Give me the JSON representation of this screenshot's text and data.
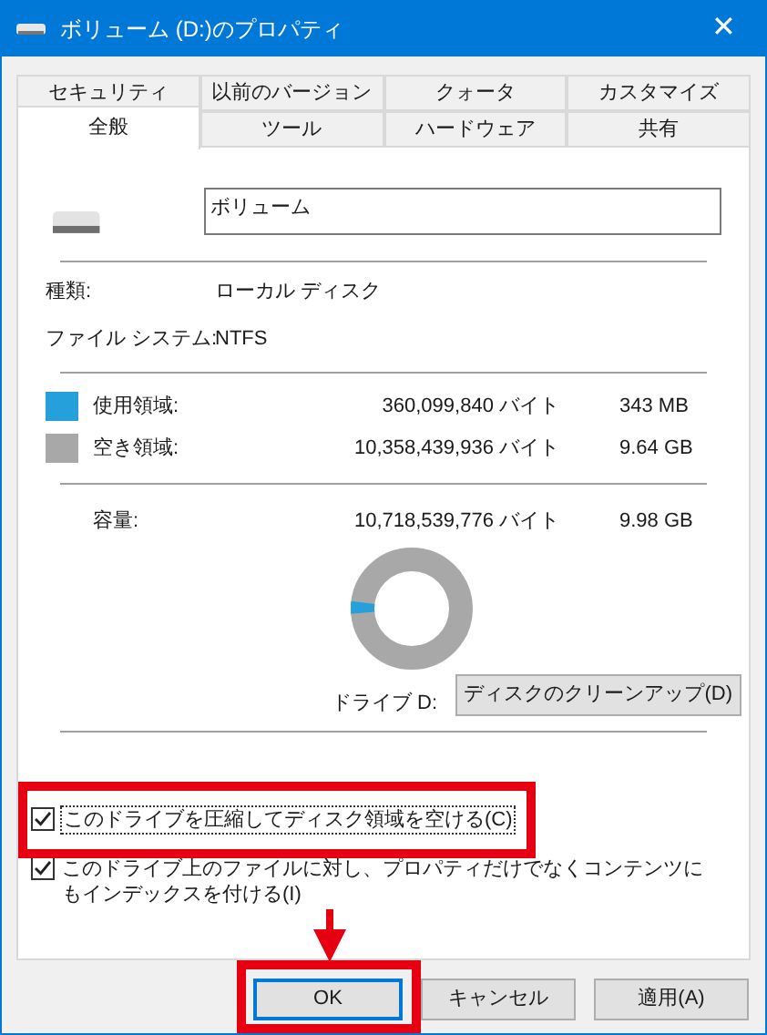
{
  "window": {
    "title": "ボリューム (D:)のプロパティ",
    "close": "✕"
  },
  "tab_rows": [
    [
      {
        "label": "セキュリティ",
        "selected": false
      },
      {
        "label": "以前のバージョン",
        "selected": false
      },
      {
        "label": "クォータ",
        "selected": false
      },
      {
        "label": "カスタマイズ",
        "selected": false
      }
    ],
    [
      {
        "label": "全般",
        "selected": true
      },
      {
        "label": "ツール",
        "selected": false
      },
      {
        "label": "ハードウェア",
        "selected": false
      },
      {
        "label": "共有",
        "selected": false
      }
    ]
  ],
  "volume_name": {
    "value": "ボリューム"
  },
  "info": [
    {
      "label": "種類:",
      "value": "ローカル ディスク"
    },
    {
      "label": "ファイル システム:",
      "value": "NTFS"
    }
  ],
  "space": [
    {
      "label": "使用領域:",
      "bytes": "360,099,840 バイト",
      "size": "343 MB",
      "color": "#26a0da"
    },
    {
      "label": "空き領域:",
      "bytes": "10,358,439,936 バイト",
      "size": "9.64 GB",
      "color": "#a8a8a8"
    }
  ],
  "capacity": {
    "label": "容量:",
    "bytes": "10,718,539,776 バイト",
    "size": "9.98 GB"
  },
  "drive_label": "ドライブ D:",
  "cleanup_button": "ディスクのクリーンアップ(D)",
  "options": [
    {
      "label": "このドライブを圧縮してディスク領域を空ける(C)",
      "checked": true,
      "focused": true
    },
    {
      "label": "このドライブ上のファイルに対し、プロパティだけでなくコンテンツにもインデックスを付ける(I)",
      "checked": true,
      "focused": false
    }
  ],
  "buttons": [
    {
      "label": "OK",
      "default": true
    },
    {
      "label": "キャンセル",
      "default": false
    },
    {
      "label": "適用(A)",
      "default": false
    }
  ]
}
